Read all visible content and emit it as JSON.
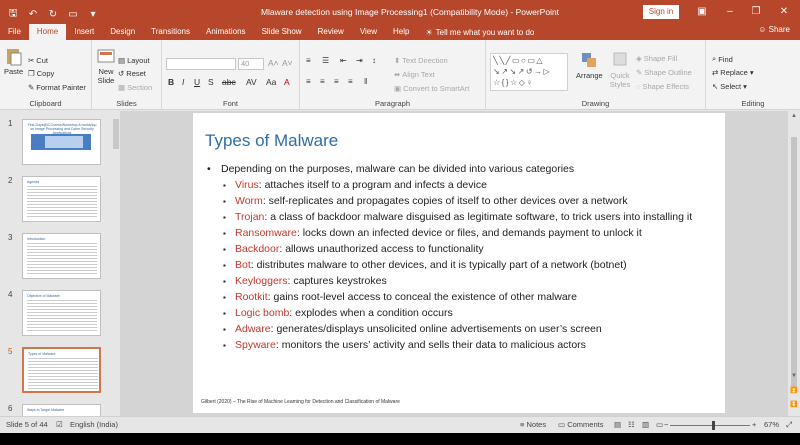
{
  "app": {
    "window_title": "Mlaware detection using Image Processing1 (Compatibility Mode)  -  PowerPoint",
    "signin_label": "Sign in",
    "share_label": "Share"
  },
  "tabs": [
    "File",
    "Home",
    "Insert",
    "Design",
    "Transitions",
    "Animations",
    "Slide Show",
    "Review",
    "View",
    "Help"
  ],
  "tell_me": "Tell me what you want to do",
  "ribbon": {
    "clipboard": {
      "paste": "Paste",
      "cut": "Cut",
      "copy": "Copy",
      "format_painter": "Format Painter",
      "label": "Clipboard"
    },
    "slides": {
      "new_slide": "New Slide",
      "layout": "Layout",
      "reset": "Reset",
      "section": "Section",
      "label": "Slides"
    },
    "font": {
      "size": "40",
      "label": "Font"
    },
    "paragraph": {
      "text_direction": "Text Direction",
      "align_text": "Align Text",
      "convert_smartart": "Convert to SmartArt",
      "label": "Paragraph"
    },
    "drawing": {
      "arrange": "Arrange",
      "quick_styles": "Quick Styles",
      "shape_fill": "Shape Fill",
      "shape_outline": "Shape Outline",
      "shape_effects": "Shape Effects",
      "label": "Drawing"
    },
    "editing": {
      "find": "Find",
      "replace": "Replace",
      "select": "Select",
      "label": "Editing"
    }
  },
  "thumbnails": [
    {
      "num": "1",
      "title": "First-Days@ICCourseWorkshop\nA workshop on Image Processing and Cyber Security Applications"
    },
    {
      "num": "2",
      "title": "Agenda"
    },
    {
      "num": "3",
      "title": "Introduction"
    },
    {
      "num": "4",
      "title": "Objective of Malware"
    },
    {
      "num": "5",
      "title": "Types of Malware"
    },
    {
      "num": "6",
      "title": "Ways to Target Malware"
    }
  ],
  "slide": {
    "title": "Types of Malware",
    "intro": "Depending on the purposes, malware can be divided into various categories",
    "items": [
      {
        "term": "Virus",
        "desc": ": attaches itself to a program and infects a device"
      },
      {
        "term": "Worm",
        "desc": ": self-replicates and propagates copies of itself to other devices over a network"
      },
      {
        "term": "Trojan",
        "desc": ":  a class of backdoor malware disguised as legitimate software, to trick users into installing it"
      },
      {
        "term": "Ransomware",
        "desc": ": locks down an infected device or files, and demands payment to unlock it"
      },
      {
        "term": "Backdoor",
        "desc": ": allows unauthorized access to functionality"
      },
      {
        "term": "Bot",
        "desc": ": distributes malware to other devices, and it is typically part of a network (botnet)"
      },
      {
        "term": "Keyloggers",
        "desc": ": captures keystrokes"
      },
      {
        "term": "Rootkit",
        "desc": ": gains root-level access to conceal the existence of other malware"
      },
      {
        "term": "Logic bomb",
        "desc": ": explodes when a condition occurs"
      },
      {
        "term": "Adware",
        "desc": ": generates/displays unsolicited online advertisements on user’s screen"
      },
      {
        "term": "Spyware",
        "desc": ": monitors the users’ activity and sells their data to malicious actors"
      }
    ],
    "footnote": "Gilbert (2020) – The Rise of Machine Learning for Detection and Classification of Malware"
  },
  "status": {
    "slide_of": "Slide 5 of 44",
    "language": "English (India)",
    "notes": "Notes",
    "comments": "Comments",
    "zoom": "67%"
  },
  "colors": {
    "accent": "#b7472a",
    "term": "#c0392b",
    "title": "#2e6ea6"
  }
}
